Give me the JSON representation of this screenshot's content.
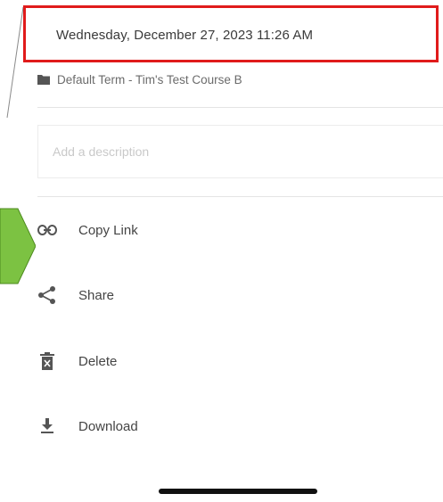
{
  "event": {
    "datetime": "Wednesday, December 27, 2023 11:26 AM",
    "course": "Default Term - Tim's Test Course B"
  },
  "description": {
    "placeholder": "Add a description"
  },
  "actions": [
    {
      "label": "Copy Link",
      "icon": "link-icon"
    },
    {
      "label": "Share",
      "icon": "share-icon"
    },
    {
      "label": "Delete",
      "icon": "trash-icon"
    },
    {
      "label": "Download",
      "icon": "download-icon"
    }
  ],
  "colors": {
    "highlight": "#e01b1b",
    "arrow": "#7cc242"
  }
}
